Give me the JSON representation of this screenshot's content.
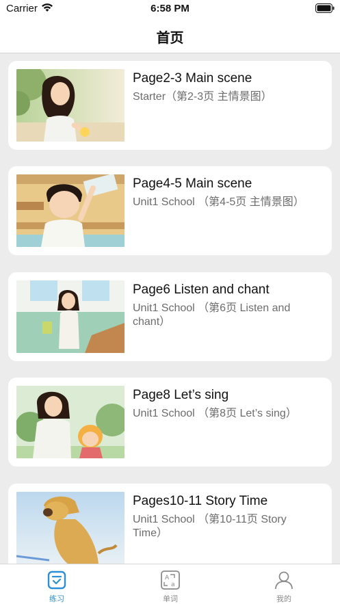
{
  "status_bar": {
    "carrier": "Carrier",
    "time": "6:58 PM"
  },
  "nav": {
    "title": "首页"
  },
  "lessons": [
    {
      "title": "Page2-3 Main scene",
      "subtitle": "Starter（第2-3页 主情景图）"
    },
    {
      "title": "Page4-5 Main scene",
      "subtitle": "Unit1 School （第4-5页 主情景图）"
    },
    {
      "title": "Page6 Listen and chant",
      "subtitle": "Unit1 School （第6页 Listen and chant）"
    },
    {
      "title": "Page8 Let’s sing",
      "subtitle": "Unit1 School （第8页 Let’s sing）"
    },
    {
      "title": "Pages10-11 Story Time",
      "subtitle": "Unit1 School （第10-11页 Story Time）"
    }
  ],
  "tabs": [
    {
      "label": "练习",
      "icon": "practice-icon",
      "active": true
    },
    {
      "label": "单词",
      "icon": "word-icon",
      "active": false
    },
    {
      "label": "我的",
      "icon": "profile-icon",
      "active": false
    }
  ],
  "colors": {
    "accent": "#2a8fd6",
    "inactive": "#8a8a8a",
    "background": "#ececec"
  }
}
